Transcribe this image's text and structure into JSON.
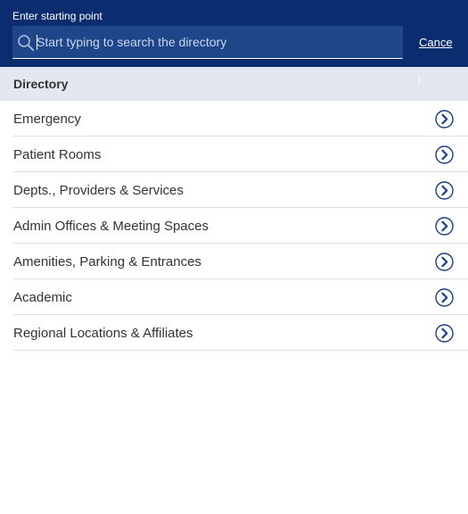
{
  "header": {
    "label": "Enter starting point",
    "cancel_label": "Cance"
  },
  "search": {
    "placeholder": "Start typing to search the directory",
    "value": ""
  },
  "section": {
    "title": "Directory"
  },
  "directory": {
    "items": [
      {
        "label": "Emergency"
      },
      {
        "label": "Patient Rooms"
      },
      {
        "label": "Depts., Providers & Services"
      },
      {
        "label": "Admin Offices & Meeting Spaces"
      },
      {
        "label": "Amenities, Parking & Entrances"
      },
      {
        "label": "Academic"
      },
      {
        "label": "Regional Locations & Affiliates"
      }
    ]
  },
  "colors": {
    "header_bg": "#0b2d6f",
    "search_bg": "#1f4688",
    "section_bg": "#e3e8f0",
    "chevron": "#1c3f86"
  },
  "icons": {
    "search": "search-icon",
    "item_arrow": "chevron-right-circle-icon"
  }
}
